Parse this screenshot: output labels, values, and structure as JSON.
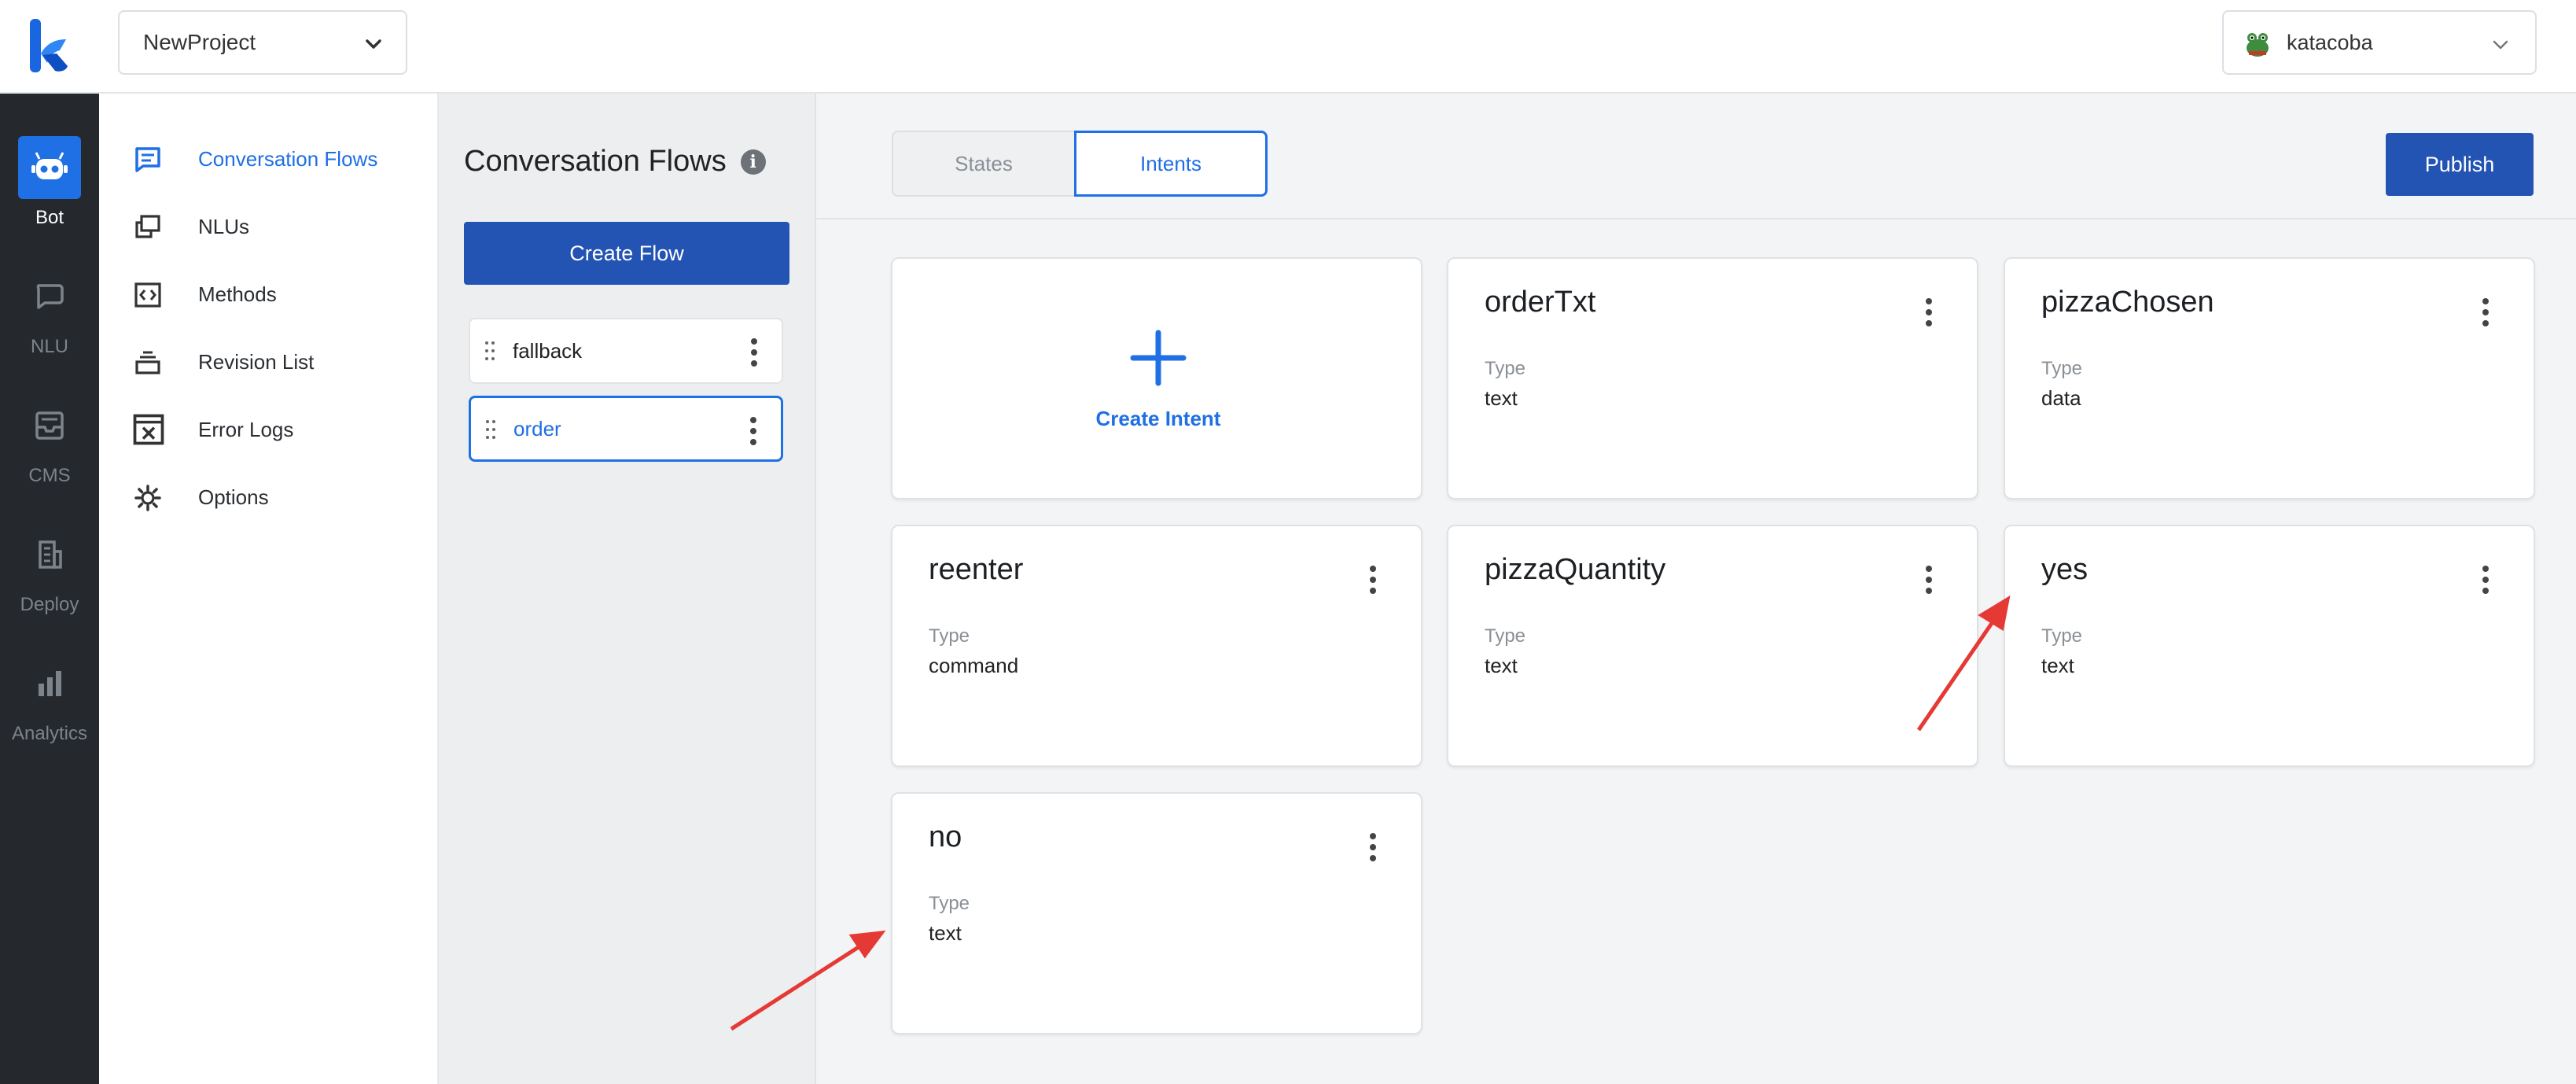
{
  "header": {
    "project": "NewProject",
    "user": "katacoba"
  },
  "rail": {
    "items": [
      {
        "label": "Bot",
        "icon": "bot-icon"
      },
      {
        "label": "NLU",
        "icon": "nlu-chat-icon"
      },
      {
        "label": "CMS",
        "icon": "cms-tray-icon"
      },
      {
        "label": "Deploy",
        "icon": "deploy-building-icon"
      },
      {
        "label": "Analytics",
        "icon": "analytics-bars-icon"
      }
    ]
  },
  "menu": {
    "items": [
      {
        "label": "Conversation Flows",
        "icon": "chat-bubble-icon"
      },
      {
        "label": "NLUs",
        "icon": "nlu-stack-icon"
      },
      {
        "label": "Methods",
        "icon": "code-icon"
      },
      {
        "label": "Revision List",
        "icon": "revision-stack-icon"
      },
      {
        "label": "Error Logs",
        "icon": "error-log-icon"
      },
      {
        "label": "Options",
        "icon": "gear-icon"
      }
    ]
  },
  "flows": {
    "title": "Conversation Flows",
    "info_icon_glyph": "i",
    "create_label": "Create Flow",
    "items": [
      "fallback",
      "order"
    ]
  },
  "main": {
    "tabs": [
      "States",
      "Intents"
    ],
    "publish_label": "Publish",
    "create_intent_label": "Create Intent",
    "type_label": "Type",
    "intents": [
      {
        "name": "orderTxt",
        "type": "text"
      },
      {
        "name": "pizzaChosen",
        "type": "data"
      },
      {
        "name": "reenter",
        "type": "command"
      },
      {
        "name": "pizzaQuantity",
        "type": "text"
      },
      {
        "name": "yes",
        "type": "text"
      },
      {
        "name": "no",
        "type": "text"
      }
    ]
  },
  "colors": {
    "accent": "#1f6fe5",
    "primary_button": "#2354b4",
    "rail_bg": "#25292e",
    "annotation_arrow": "#e53935"
  }
}
